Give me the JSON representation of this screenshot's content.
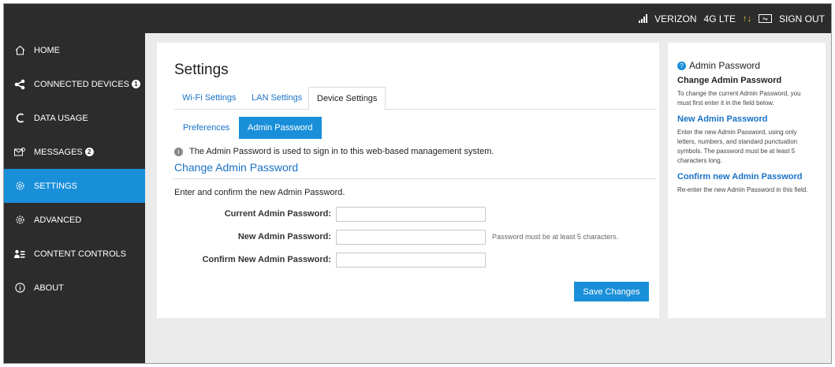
{
  "topbar": {
    "carrier": "VERIZON",
    "network": "4G LTE",
    "sign_out": "SIGN OUT"
  },
  "sidebar": {
    "items": [
      {
        "label": "HOME",
        "icon": "home-icon"
      },
      {
        "label": "CONNECTED DEVICES",
        "icon": "share-icon",
        "badge": "1"
      },
      {
        "label": "DATA USAGE",
        "icon": "data-usage-icon"
      },
      {
        "label": "MESSAGES",
        "icon": "messages-icon",
        "badge": "2"
      },
      {
        "label": "SETTINGS",
        "icon": "gear-icon",
        "active": true
      },
      {
        "label": "ADVANCED",
        "icon": "gear-icon"
      },
      {
        "label": "CONTENT CONTROLS",
        "icon": "users-icon"
      },
      {
        "label": "ABOUT",
        "icon": "info-icon"
      }
    ]
  },
  "main": {
    "title": "Settings",
    "tabs": [
      {
        "label": "Wi-Fi Settings"
      },
      {
        "label": "LAN Settings"
      },
      {
        "label": "Device Settings",
        "active": true
      }
    ],
    "subtabs": [
      {
        "label": "Preferences"
      },
      {
        "label": "Admin Password",
        "active": true
      }
    ],
    "info_text": "The Admin Password is used to sign in to this web-based management system.",
    "section_title": "Change Admin Password",
    "intro": "Enter and confirm the new Admin Password.",
    "fields": {
      "current_label": "Current Admin Password:",
      "new_label": "New Admin Password:",
      "new_hint": "Password must be at least 5 characters.",
      "confirm_label": "Confirm New Admin Password:"
    },
    "save_label": "Save Changes"
  },
  "help": {
    "title": "Admin Password",
    "h1": "Change Admin Password",
    "p1": "To change the current Admin Password, you must first enter it in the field below.",
    "h2": "New Admin Password",
    "p2": "Enter the new Admin Password, using only letters, numbers, and standard punctuation symbols. The password must be at least 5 characters long.",
    "h3": "Confirm new Admin Password",
    "p3": "Re-enter the new Admin Password in this field."
  },
  "colors": {
    "accent": "#1a8fd9",
    "sidebar_bg": "#2c2c2c",
    "link": "#1a73c8"
  }
}
